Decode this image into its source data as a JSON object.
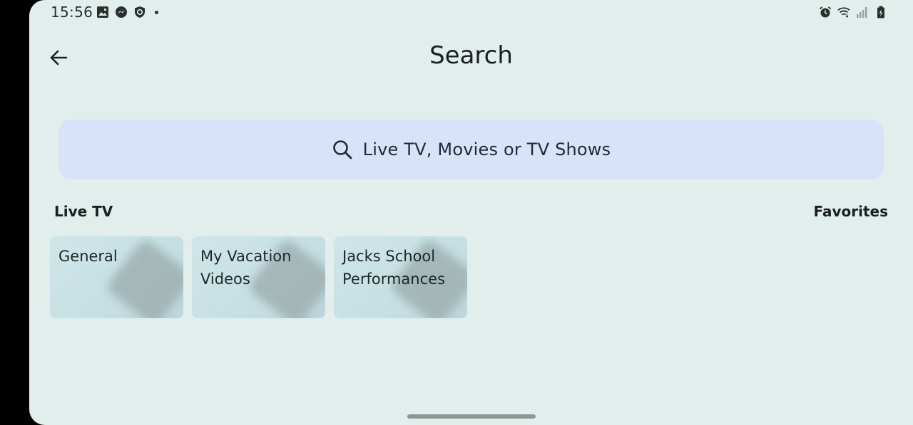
{
  "status_bar": {
    "time": "15:56",
    "left_icons": [
      "gallery-icon",
      "messenger-icon",
      "shield-icon",
      "notification-dot"
    ],
    "right_icons": [
      "alarm-icon",
      "wifi-icon",
      "signal-icon",
      "battery-icon"
    ]
  },
  "header": {
    "title": "Search",
    "back_icon": "arrow-left-icon"
  },
  "search": {
    "placeholder": "Live TV, Movies or TV Shows",
    "icon": "search-icon"
  },
  "live_tv": {
    "section_title": "Live TV",
    "favorites_label": "Favorites",
    "channels": [
      {
        "label": "General"
      },
      {
        "label": "My Vacation\nVideos"
      },
      {
        "label": "Jacks School\nPerformances"
      }
    ]
  },
  "colors": {
    "background": "#e2eeec",
    "search_bar": "#d6e3f8",
    "card": "#c6e0e3"
  }
}
